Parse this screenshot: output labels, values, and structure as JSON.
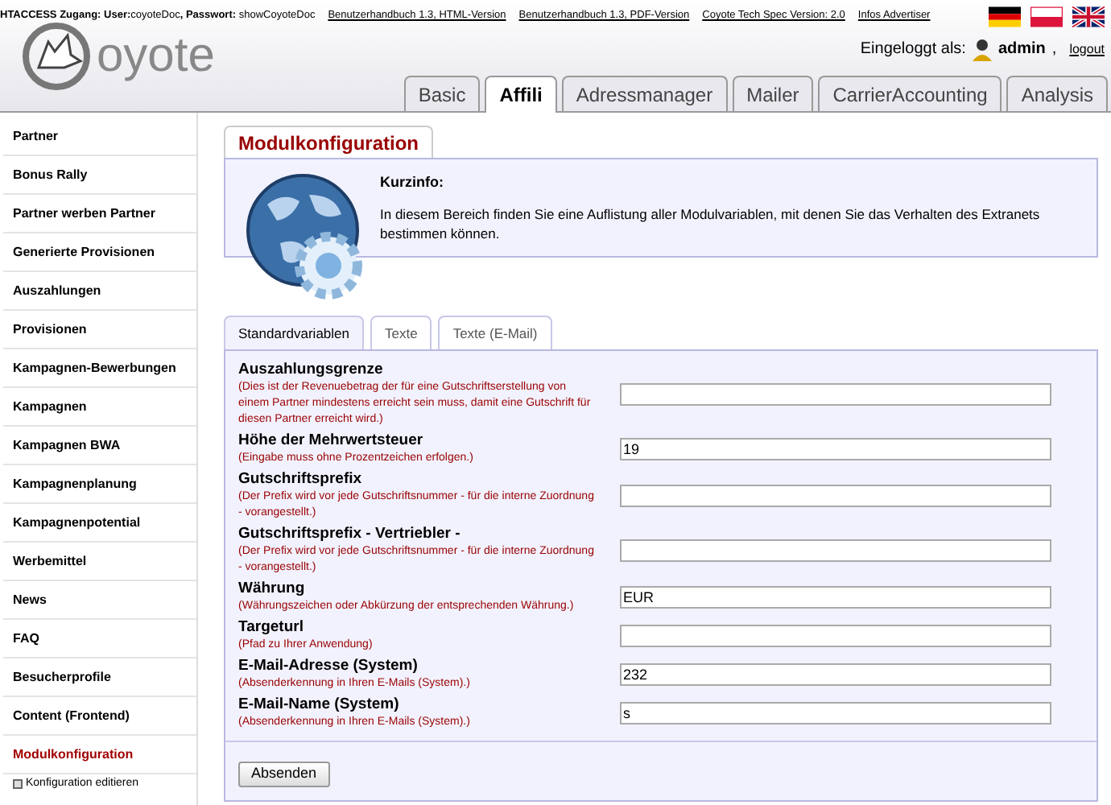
{
  "top_bar": {
    "access_label": "HTACCESS Zugang: User:",
    "user": "coyoteDoc",
    "password_label": ", Passwort:",
    "password": "showCoyoteDoc",
    "links": [
      "Benutzerhandbuch 1.3, HTML-Version",
      "Benutzerhandbuch 1.3, PDF-Version",
      "Coyote Tech Spec Version: 2.0",
      "Infos Advertiser"
    ],
    "flags": [
      {
        "kind": "tricolor"
      },
      {
        "kind": "bicolor"
      },
      {
        "kind": "union"
      }
    ]
  },
  "header": {
    "logo": "oyote",
    "login_label": "Eingeloggt als:",
    "user": "admin",
    "separator": ",",
    "logout": "logout",
    "tabs": [
      {
        "label": "Basic",
        "selected": false
      },
      {
        "label": "Affili",
        "selected": true
      },
      {
        "label": "Adressmanager",
        "selected": false
      },
      {
        "label": "Mailer",
        "selected": false
      },
      {
        "label": "CarrierAccounting",
        "selected": false
      },
      {
        "label": "Analysis",
        "selected": false
      }
    ]
  },
  "sidebar": {
    "items": [
      {
        "label": "Partner",
        "selected": false
      },
      {
        "label": "Bonus Rally",
        "selected": false
      },
      {
        "label": "Partner werben Partner",
        "selected": false
      },
      {
        "label": "Generierte Provisionen",
        "selected": false
      },
      {
        "label": "Auszahlungen",
        "selected": false
      },
      {
        "label": "Provisionen",
        "selected": false
      },
      {
        "label": "Kampagnen-Bewerbungen",
        "selected": false
      },
      {
        "label": "Kampagnen",
        "selected": false
      },
      {
        "label": "Kampagnen BWA",
        "selected": false
      },
      {
        "label": "Kampagnenplanung",
        "selected": false
      },
      {
        "label": "Kampagnenpotential",
        "selected": false
      },
      {
        "label": "Werbemittel",
        "selected": false
      },
      {
        "label": "News",
        "selected": false
      },
      {
        "label": "FAQ",
        "selected": false
      },
      {
        "label": "Besucherprofile",
        "selected": false
      },
      {
        "label": "Content (Frontend)",
        "selected": false
      },
      {
        "label": "Modulkonfiguration",
        "selected": true,
        "children": [
          {
            "label": "Konfiguration editieren"
          }
        ]
      }
    ]
  },
  "page": {
    "title": "Modulkonfiguration",
    "info_title": "Kurzinfo:",
    "info_text": "In diesem Bereich finden Sie eine Auflistung aller Modulvariablen, mit denen Sie das Verhalten des Extranets bestimmen können.",
    "tabs": [
      {
        "label": "Standardvariablen",
        "selected": true
      },
      {
        "label": "Texte",
        "selected": false
      },
      {
        "label": "Texte (E-Mail)",
        "selected": false
      }
    ],
    "fields": [
      {
        "label": "Auszahlungsgrenze",
        "hint": "(Dies ist der Revenuebetrag der für eine Gutschriftserstellung von einem Partner mindestens erreicht sein muss, damit eine Gutschrift für diesen Partner erreicht wird.)"
      },
      {
        "label": "Höhe der Mehrwertsteuer",
        "hint": "(Eingabe muss ohne Prozentzeichen erfolgen.)",
        "value": "19"
      },
      {
        "label": "Gutschriftsprefix",
        "hint": "(Der Prefix wird vor jede Gutschriftsnummer - für die interne Zuordnung - vorangestellt.)"
      },
      {
        "label": "Gutschriftsprefix - Vertriebler -",
        "hint": "(Der Prefix wird vor jede Gutschriftsnummer - für die interne Zuordnung - vorangestellt.)"
      },
      {
        "label": "Währung",
        "hint": "(Währungszeichen oder Abkürzung der entsprechenden Währung.)",
        "value": "EUR"
      },
      {
        "label": "Targeturl",
        "hint": "(Pfad zu Ihrer Anwendung)"
      },
      {
        "label": "E-Mail-Adresse (System)",
        "hint": "(Absenderkennung in Ihren E-Mails (System).)",
        "value": "232"
      },
      {
        "label": "E-Mail-Name (System)",
        "hint": "(Absenderkennung in Ihren E-Mails (System).)",
        "value": "s"
      }
    ],
    "submit": "Absenden"
  }
}
